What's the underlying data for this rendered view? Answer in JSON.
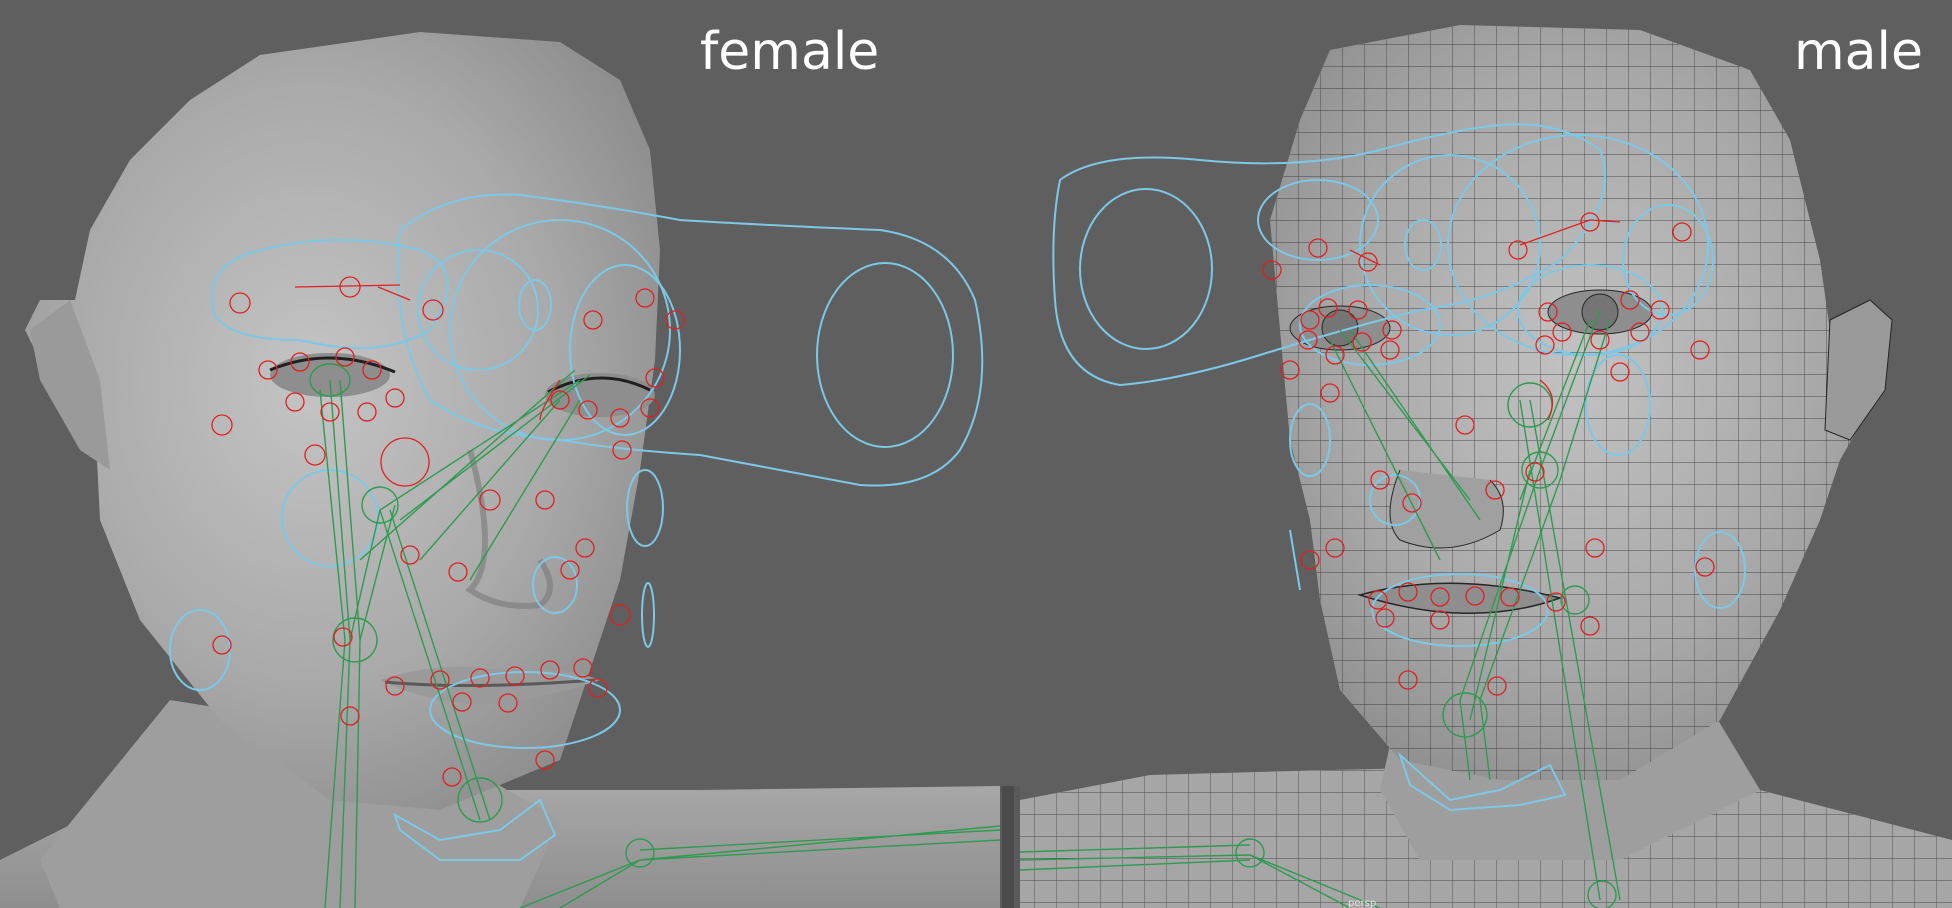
{
  "labels": {
    "female": "female",
    "male": "male"
  },
  "camera_label": "persp",
  "colors": {
    "background": "#5f5f5f",
    "skin_light": "#b8b8b8",
    "skin_mid": "#9b9b9b",
    "skin_dark": "#7a7a7a",
    "mesh_wire": "#202020",
    "control_curve": "#7cc8e6",
    "joint": "#e02020",
    "bone": "#2e9b50",
    "label": "#ffffff"
  }
}
